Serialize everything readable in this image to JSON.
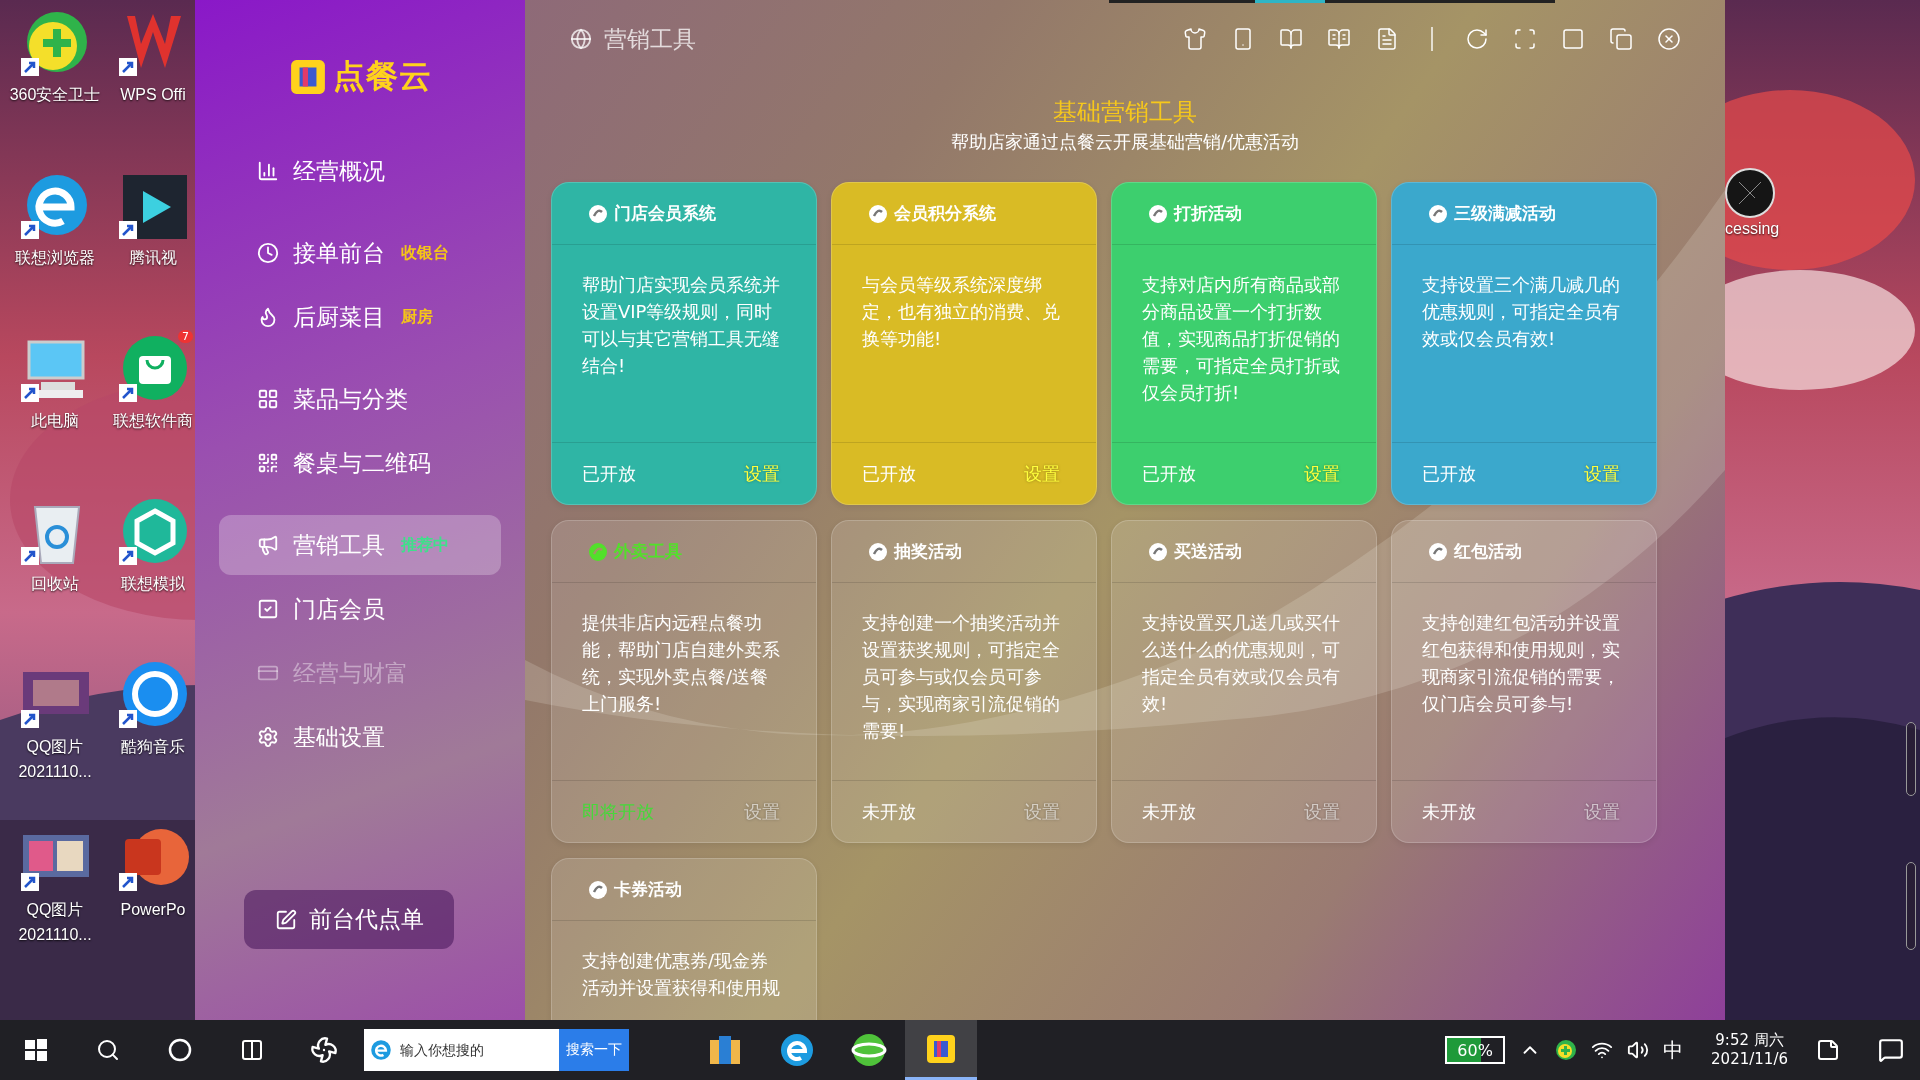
{
  "desktop": {
    "icons": [
      {
        "label": "360安全卫士"
      },
      {
        "label": "联想浏览器"
      },
      {
        "label": "此电脑"
      },
      {
        "label": "回收站"
      },
      {
        "label": "QQ图片",
        "sublabel": "2021110..."
      },
      {
        "label": "QQ图片",
        "sublabel": "2021110..."
      },
      {
        "label": "WPS Offi"
      },
      {
        "label": "腾讯视"
      },
      {
        "label": "联想软件商",
        "badge": "7"
      },
      {
        "label": "联想模拟"
      },
      {
        "label": "酷狗音乐"
      },
      {
        "label": "PowerPo"
      }
    ],
    "right_icon": {
      "label": "cessing"
    }
  },
  "app": {
    "logo": "点餐云",
    "sidebar": {
      "groups": [
        {
          "items": [
            {
              "label": "经营概况",
              "selected": false,
              "disabled": false
            }
          ]
        },
        {
          "items": [
            {
              "label": "接单前台",
              "selected": false,
              "disabled": false,
              "badge": {
                "text": "收银台",
                "color": "#f5c518"
              }
            },
            {
              "label": "后厨菜目",
              "selected": false,
              "disabled": false,
              "badge": {
                "text": "厨房",
                "color": "#f5c518"
              }
            }
          ]
        },
        {
          "items": [
            {
              "label": "菜品与分类",
              "selected": false,
              "disabled": false
            },
            {
              "label": "餐桌与二维码",
              "selected": false,
              "disabled": false
            }
          ]
        },
        {
          "items": [
            {
              "label": "营销工具",
              "selected": true,
              "disabled": false,
              "badge": {
                "text": "推荐中",
                "color": "#3ee08a"
              }
            },
            {
              "label": "门店会员",
              "selected": false,
              "disabled": false
            },
            {
              "label": "经营与财富",
              "selected": false,
              "disabled": true
            },
            {
              "label": "基础设置",
              "selected": false,
              "disabled": false
            }
          ]
        }
      ]
    },
    "action_button": "前台代点单",
    "page_title": "营销工具",
    "section_title": "基础营销工具",
    "section_subtitle": "帮助店家通过点餐云开展基础营销/优惠活动",
    "cards": [
      {
        "title": "门店会员系统",
        "description": "帮助门店实现会员系统并设置VIP等级规则，同时可以与其它营销工具无缝结合!",
        "status": "已开放",
        "kind": "open",
        "settings": "设置",
        "color": "#2fb5a5"
      },
      {
        "title": "会员积分系统",
        "description": "与会员等级系统深度绑定，也有独立的消费、兑换等功能!",
        "status": "已开放",
        "kind": "open",
        "settings": "设置",
        "color": "#d9bb25"
      },
      {
        "title": "打折活动",
        "description": "支持对店内所有商品或部分商品设置一个打折数值，实现商品打折促销的需要，可指定全员打折或仅会员打折!",
        "status": "已开放",
        "kind": "open",
        "settings": "设置",
        "color": "#3dcf6e"
      },
      {
        "title": "三级满减活动",
        "description": "支持设置三个满几减几的优惠规则，可指定全员有效或仅会员有效!",
        "status": "已开放",
        "kind": "open",
        "settings": "设置",
        "color": "#3ba8cc"
      },
      {
        "title": "外卖工具",
        "description": "提供非店内远程点餐功能，帮助门店自建外卖系统，实现外卖点餐/送餐上门服务!",
        "status": "即将开放",
        "kind": "soon",
        "settings": "设置"
      },
      {
        "title": "抽奖活动",
        "description": "支持创建一个抽奖活动并设置获奖规则，可指定全员可参与或仅会员可参与，实现商家引流促销的需要!",
        "status": "未开放",
        "kind": "closed",
        "settings": "设置"
      },
      {
        "title": "买送活动",
        "description": "支持设置买几送几或买什么送什么的优惠规则，可指定全员有效或仅会员有效!",
        "status": "未开放",
        "kind": "closed",
        "settings": "设置"
      },
      {
        "title": "红包活动",
        "description": "支持创建红包活动并设置红包获得和使用规则，实现商家引流促销的需要，仅门店会员可参与!",
        "status": "未开放",
        "kind": "closed",
        "settings": "设置"
      },
      {
        "title": "卡券活动",
        "description": "支持创建优惠券/现金券活动并设置获得和使用规",
        "kind": "closed"
      }
    ]
  },
  "taskbar": {
    "search_placeholder": "输入你想搜的",
    "search_button": "搜索一下",
    "apps": [
      {
        "selected": false
      },
      {
        "selected": false
      },
      {
        "selected": false
      },
      {
        "selected": true
      }
    ],
    "battery": "60%",
    "ime": "中",
    "time": "9:52 周六",
    "date": "2021/11/6"
  }
}
